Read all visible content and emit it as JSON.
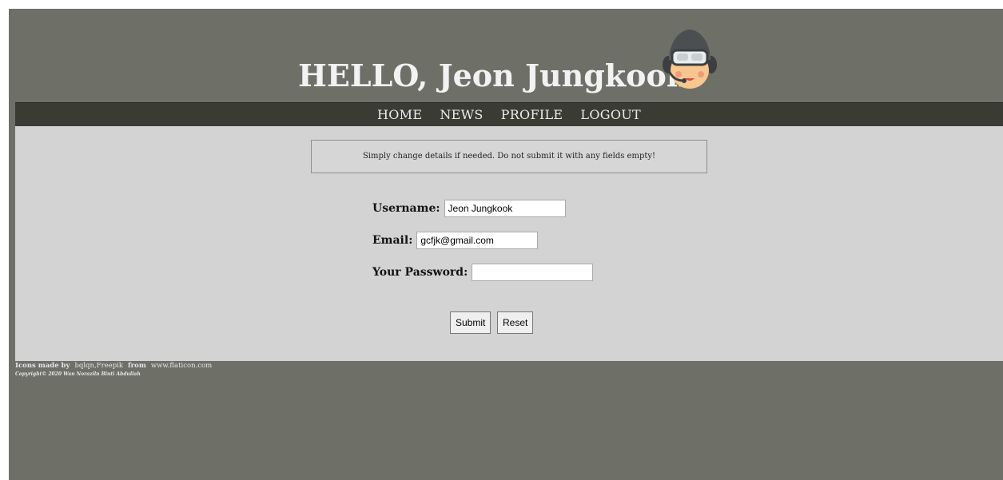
{
  "header": {
    "title": "HELLO, Jeon Jungkook",
    "avatar_icon": "pilot-avatar-icon"
  },
  "nav": {
    "items": [
      {
        "label": "HOME"
      },
      {
        "label": "NEWS"
      },
      {
        "label": "PROFILE"
      },
      {
        "label": "LOGOUT"
      }
    ]
  },
  "notice": {
    "text": "Simply change details if needed. Do not submit it with any fields empty!"
  },
  "form": {
    "username_label": "Username:",
    "username_value": "Jeon Jungkook",
    "email_label": "Email:",
    "email_value": "gcfjk@gmail.com",
    "password_label": "Your Password:",
    "password_value": "",
    "submit_label": "Submit",
    "reset_label": "Reset"
  },
  "footer": {
    "icons_made_by": "Icons made by",
    "authors": "bqlqn,Freepik",
    "from": "from",
    "site": "www.flaticon.com",
    "copyright": "Copyright© 2020 Wan Noraziln Binti Abdullah"
  },
  "colors": {
    "page_bg": "#6e7068",
    "nav_bg": "#3a3c33",
    "content_bg": "#d3d3d3",
    "title_color": "#f2f2f2"
  }
}
